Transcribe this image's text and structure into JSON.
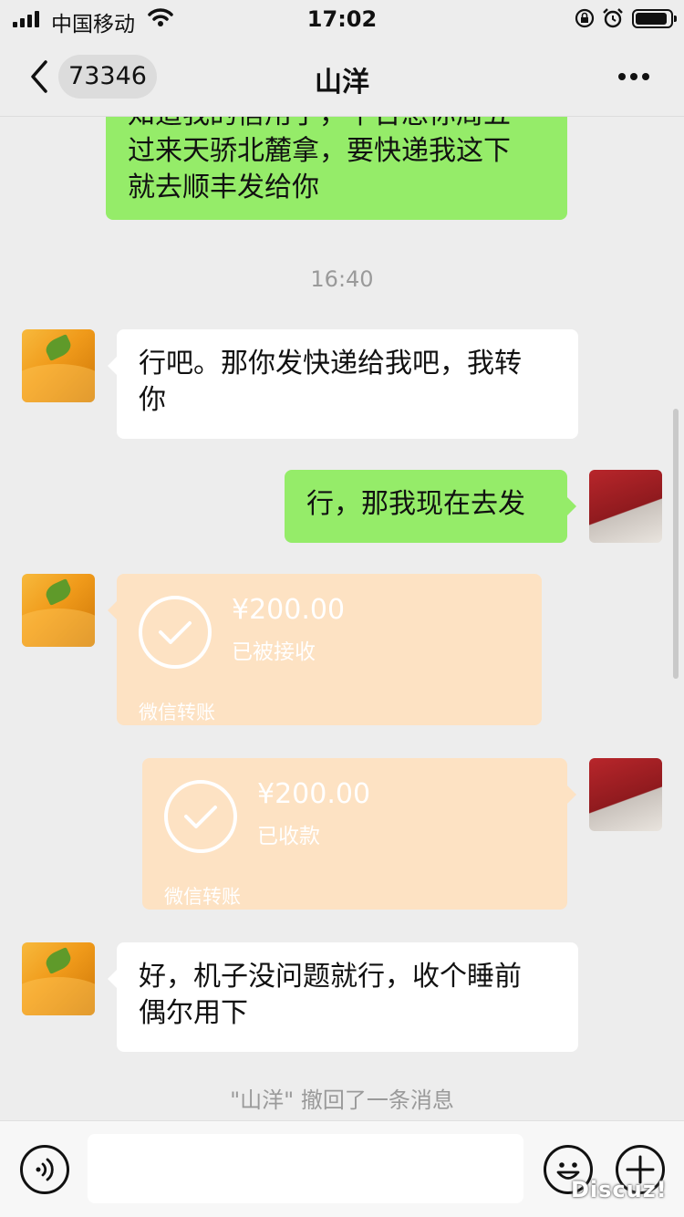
{
  "status_bar": {
    "carrier": "中国移动",
    "time": "17:02"
  },
  "nav": {
    "unread_count": "73346",
    "title": "山洋"
  },
  "messages": {
    "m1_line1": "知道我的信用了，平台想你周五",
    "m1_line2": "过来天骄北麓拿，要快递我这下",
    "m1_line3": "就去顺丰发给你",
    "timestamp": "16:40",
    "m2_line1": "行吧。那你发快递给我吧，我转",
    "m2_line2": "你",
    "m3": "行，那我现在去发",
    "m6_line1": "好，机子没问题就行，收个睡前",
    "m6_line2": "偶尔用下",
    "recall": "\"山洋\" 撤回了一条消息"
  },
  "transfers": [
    {
      "amount": "¥200.00",
      "status": "已被接收",
      "label": "微信转账"
    },
    {
      "amount": "¥200.00",
      "status": "已收款",
      "label": "微信转账"
    }
  ],
  "watermark": "Discuz!",
  "colors": {
    "sent_bubble": "#95ec69",
    "received_bubble": "#ffffff",
    "transfer_bubble": "#fde2c3",
    "background": "#ededed"
  },
  "icons": [
    "signal-icon",
    "wifi-icon",
    "lock-rotation-icon",
    "alarm-icon",
    "battery-icon",
    "back-chevron-icon",
    "more-icon",
    "check-icon",
    "voice-icon",
    "emoji-icon",
    "plus-icon"
  ]
}
